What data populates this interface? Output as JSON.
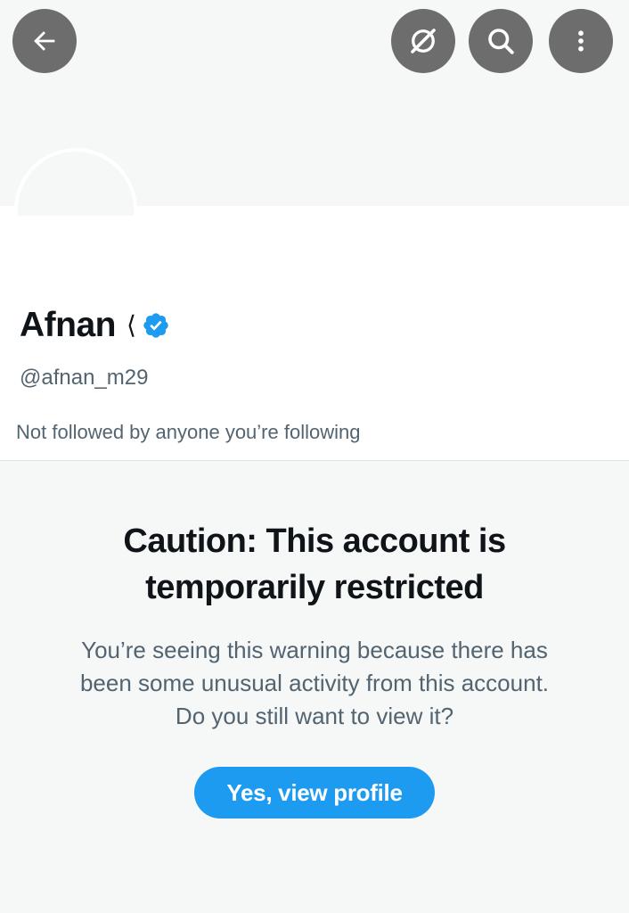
{
  "header": {
    "back_icon": "arrow-left-icon",
    "grok_icon": "grok-icon",
    "search_icon": "search-icon",
    "more_icon": "more-vertical-icon"
  },
  "profile": {
    "display_name": "Afnan",
    "name_glyph": "⟨",
    "verified_icon": "verified-badge-icon",
    "verified_color": "#1d9bf0",
    "handle": "@afnan_m29",
    "followed_by": "Not followed by anyone you’re following"
  },
  "warning": {
    "title_line1": "Caution: This account is",
    "title_line2": "temporarily restricted",
    "body_line1": "You’re seeing this warning because there has",
    "body_line2": "been some unusual activity from this account.",
    "body_line3": "Do you still want to view it?",
    "button_label": "Yes, view profile",
    "button_color": "#1d9bf0"
  }
}
